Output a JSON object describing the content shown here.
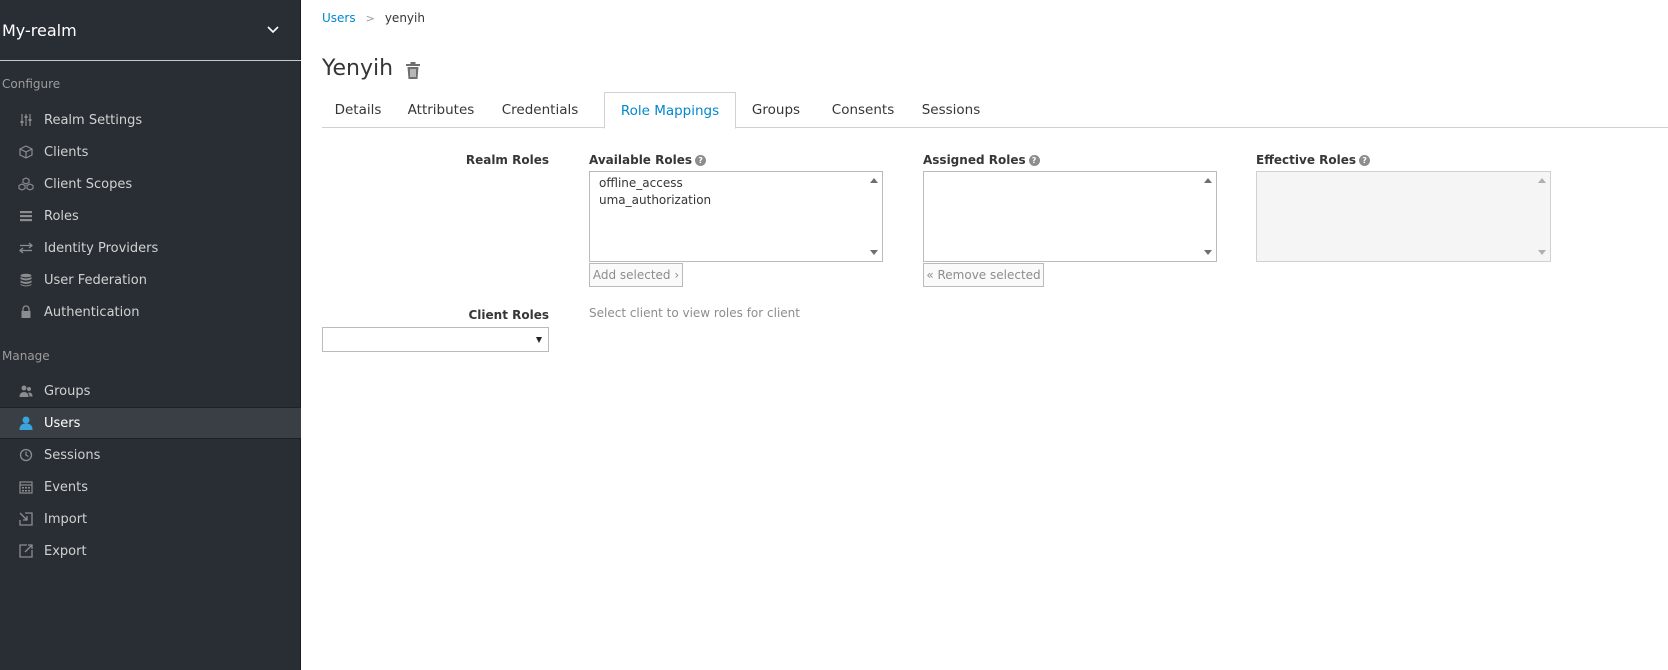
{
  "realm": {
    "name": "My-realm"
  },
  "sidebar": {
    "configure_label": "Configure",
    "manage_label": "Manage",
    "configure_items": [
      {
        "label": "Realm Settings",
        "icon": "sliders-icon"
      },
      {
        "label": "Clients",
        "icon": "cube-icon"
      },
      {
        "label": "Client Scopes",
        "icon": "cubes-icon"
      },
      {
        "label": "Roles",
        "icon": "list-icon"
      },
      {
        "label": "Identity Providers",
        "icon": "exchange-icon"
      },
      {
        "label": "User Federation",
        "icon": "database-icon"
      },
      {
        "label": "Authentication",
        "icon": "lock-icon"
      }
    ],
    "manage_items": [
      {
        "label": "Groups",
        "icon": "users-icon"
      },
      {
        "label": "Users",
        "icon": "user-icon",
        "active": true
      },
      {
        "label": "Sessions",
        "icon": "clock-icon"
      },
      {
        "label": "Events",
        "icon": "calendar-icon"
      },
      {
        "label": "Import",
        "icon": "import-icon"
      },
      {
        "label": "Export",
        "icon": "export-icon"
      }
    ]
  },
  "breadcrumb": {
    "parent": "Users",
    "separator": ">",
    "current": "yenyih"
  },
  "page": {
    "title": "Yenyih"
  },
  "tabs": [
    {
      "label": "Details"
    },
    {
      "label": "Attributes"
    },
    {
      "label": "Credentials"
    },
    {
      "label": "Role Mappings",
      "active": true
    },
    {
      "label": "Groups"
    },
    {
      "label": "Consents"
    },
    {
      "label": "Sessions"
    }
  ],
  "role_mappings": {
    "realm_roles_label": "Realm Roles",
    "available_roles_label": "Available Roles",
    "assigned_roles_label": "Assigned Roles",
    "effective_roles_label": "Effective Roles",
    "available_roles": [
      "offline_access",
      "uma_authorization"
    ],
    "assigned_roles": [],
    "effective_roles": [],
    "add_selected_label": "Add selected ›",
    "remove_selected_label": "« Remove selected",
    "client_roles_label": "Client Roles",
    "client_hint": "Select client to view roles for client",
    "client_select_value": ""
  },
  "colors": {
    "sidebar_bg": "#292e34",
    "accent": "#0088ce",
    "active_icon": "#39a5dc"
  }
}
